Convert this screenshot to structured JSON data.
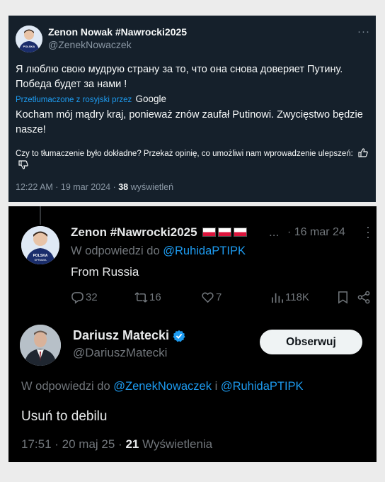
{
  "tweet1": {
    "display_name": "Zenon Nowak #Nawrocki2025",
    "handle": "@ZenekNowaczek",
    "more": "···",
    "original_text": "Я люблю свою мудрую страну за то, что она снова доверяет Путину. Победа будет за нами !",
    "translated_label": "Przetłumaczone z rosyjski przez",
    "translator": "Google",
    "translated_text": "Kocham mój mądry kraj, ponieważ znów zaufał Putinowi. Zwycięstwo będzie nasze!",
    "feedback_text": "Czy to tłumaczenie było dokładne? Przekaż opinię, co umożliwi nam wprowadzenie ulepszeń:",
    "time": "12:22 AM · 19 mar 2024 ·",
    "views_count": "38",
    "views_label": "wyświetleń",
    "avatar_text": "POLSKA SPRAWA"
  },
  "tweet2": {
    "display_name": "Zenon #Nawrocki2025",
    "ellipsis": "...",
    "date": "· 16 mar 24",
    "reply_prefix": "W odpowiedzi do",
    "reply_mention": "@RuhidaPTIPK",
    "text": "From Russia",
    "replies": "32",
    "reposts": "16",
    "likes": "7",
    "views": "118K",
    "avatar_text": "POLSKA SPRAWA"
  },
  "tweet3": {
    "display_name": "Dariusz Matecki",
    "handle": "@DariuszMatecki",
    "follow_label": "Obserwuj",
    "reply_prefix": "W odpowiedzi do",
    "reply_mention1": "@ZenekNowaczek",
    "reply_and": "i",
    "reply_mention2": "@RuhidaPTIPK",
    "text": "Usuń to debilu",
    "time": "17:51 · 20 maj 25 ·",
    "views_count": "21",
    "views_label": "Wyświetlenia"
  },
  "colors": {
    "dim_bg": "#15202b",
    "black_bg": "#000000",
    "accent": "#1d9bf0",
    "muted": "#71767b",
    "page_bg": "#ececec"
  }
}
